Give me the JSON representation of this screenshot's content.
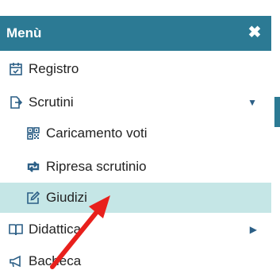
{
  "menu": {
    "title": "Menù",
    "close_symbol": "✖",
    "items": [
      {
        "label": "Registro",
        "icon": "calendar-check-icon"
      },
      {
        "label": "Scrutini",
        "icon": "file-export-icon",
        "expanded": true
      },
      {
        "label": "Caricamento voti",
        "icon": "qrcode-icon"
      },
      {
        "label": "Ripresa scrutinio",
        "icon": "retweet-icon"
      },
      {
        "label": "Giudizi",
        "icon": "edit-icon",
        "active": true
      },
      {
        "label": "Didattica",
        "icon": "book-open-icon"
      },
      {
        "label": "Bacheca",
        "icon": "bullhorn-icon"
      }
    ]
  },
  "colors": {
    "header_bg": "#2c7a94",
    "active_bg": "#c5e6e6",
    "icon_color": "#2c5f86",
    "annotation_arrow": "#e8201c"
  }
}
